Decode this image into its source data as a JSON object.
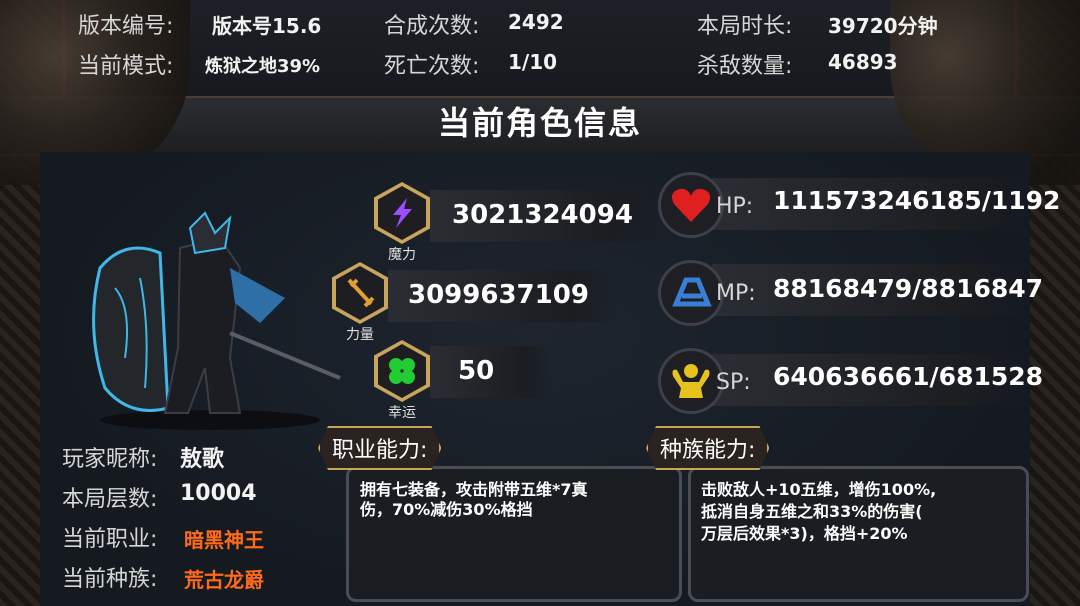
{
  "header": {
    "version_label": "版本编号:",
    "version_value": "版本号15.6",
    "mode_label": "当前模式:",
    "mode_value": "炼狱之地39%",
    "synth_label": "合成次数:",
    "synth_value": "2492",
    "death_label": "死亡次数:",
    "death_value": "1/10",
    "duration_label": "本局时长:",
    "duration_value": "39720分钟",
    "kills_label": "杀敌数量:",
    "kills_value": "46893"
  },
  "title": "当前角色信息",
  "attributes": [
    {
      "name": "魔力",
      "value": "3021324094",
      "icon": "lightning-icon",
      "color": "#9b4dff"
    },
    {
      "name": "力量",
      "value": "3099637109",
      "icon": "sword-icon",
      "color": "#e0a030"
    },
    {
      "name": "幸运",
      "value": "50",
      "icon": "clover-icon",
      "color": "#22cc33"
    }
  ],
  "resources": [
    {
      "name": "HP:",
      "value": "111573246185/1192",
      "icon": "heart-icon",
      "color": "#e02020"
    },
    {
      "name": "MP:",
      "value": "88168479/8816847",
      "icon": "mana-icon",
      "color": "#3a7fd6"
    },
    {
      "name": "SP:",
      "value": "640636661/681528",
      "icon": "strength-icon",
      "color": "#e6c21e"
    }
  ],
  "player": {
    "nickname_label": "玩家昵称:",
    "nickname_value": "敖歌",
    "floor_label": "本局层数:",
    "floor_value": "10004",
    "class_label": "当前职业:",
    "class_value": "暗黑神王",
    "race_label": "当前种族:",
    "race_value": "荒古龙爵"
  },
  "abilities": {
    "class_title": "职业能力:",
    "class_desc_1": "拥有七装备，攻击附带五维*7真",
    "class_desc_2": "伤，70%减伤30%格挡",
    "race_title": "种族能力:",
    "race_desc_1": "击败敌人+10五维，增伤100%,",
    "race_desc_2": "抵消自身五维之和33%的伤害(",
    "race_desc_3": "万层后效果*3)，格挡+20%"
  },
  "colors": {
    "accent_gold": "#c9a45c",
    "frame_red": "#8a1a1a",
    "highlight_orange": "#ff6a1a"
  }
}
